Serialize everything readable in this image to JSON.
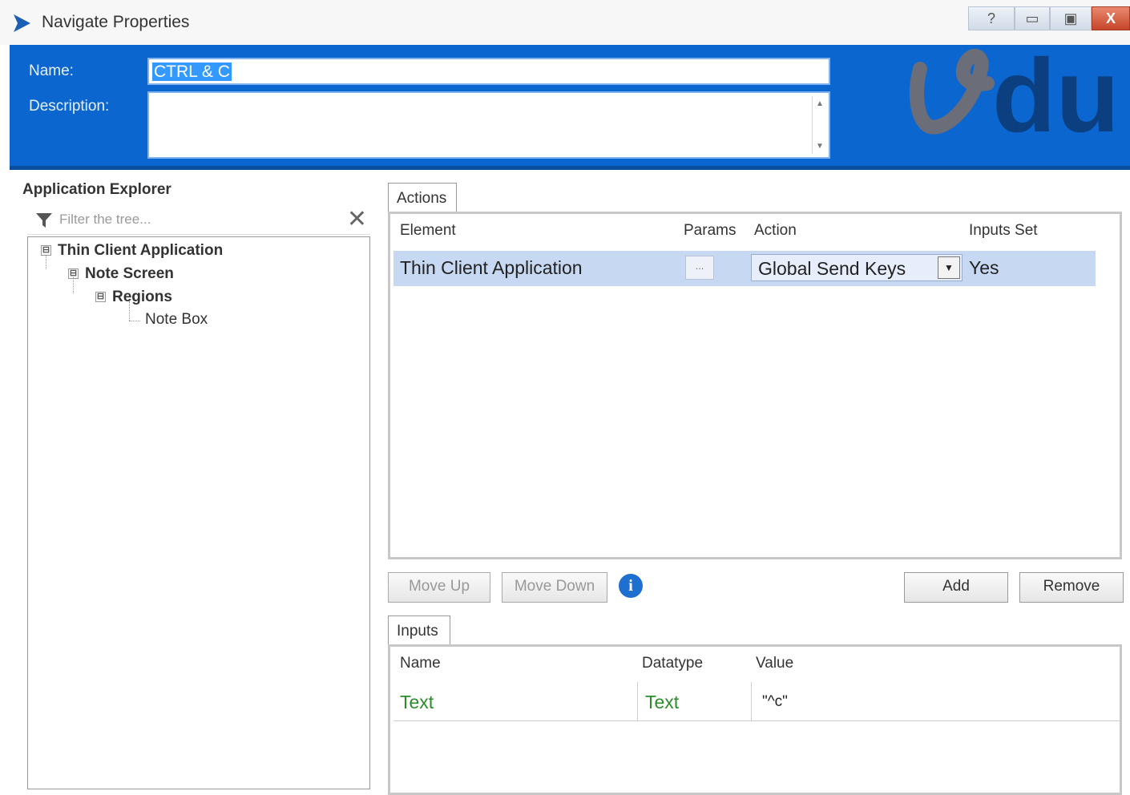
{
  "window": {
    "title": "Navigate Properties",
    "buttons": {
      "help": "?",
      "minimize": "▭",
      "maximize": "▣",
      "close": "X"
    }
  },
  "header": {
    "name_label": "Name:",
    "name_value": "CTRL & C",
    "description_label": "Description:",
    "description_value": "",
    "logo_text": "du"
  },
  "explorer": {
    "title": "Application Explorer",
    "filter_placeholder": "Filter the tree...",
    "tree": [
      {
        "label": "Thin Client Application",
        "expander": "⊟"
      },
      {
        "label": "Note Screen",
        "expander": "⊟"
      },
      {
        "label": "Regions",
        "expander": "⊟"
      },
      {
        "label": "Note Box"
      }
    ]
  },
  "actions": {
    "tab_label": "Actions",
    "columns": [
      "Element",
      "Params",
      "Action",
      "Inputs Set"
    ],
    "rows": [
      {
        "element": "Thin Client Application",
        "params": "...",
        "action": "Global Send Keys",
        "inputs_set": "Yes"
      }
    ]
  },
  "buttons": {
    "move_up": "Move Up",
    "move_down": "Move Down",
    "info": "i",
    "add": "Add",
    "remove": "Remove"
  },
  "inputs": {
    "tab_label": "Inputs",
    "columns": [
      "Name",
      "Datatype",
      "Value"
    ],
    "rows": [
      {
        "name": "Text",
        "datatype": "Text",
        "value": "\"^c\""
      }
    ]
  },
  "colors": {
    "header_blue": "#0c66cf",
    "selected_row": "#c7d8f2",
    "input_green": "#2c8c2c",
    "logo_grey": "#6b6e78"
  }
}
